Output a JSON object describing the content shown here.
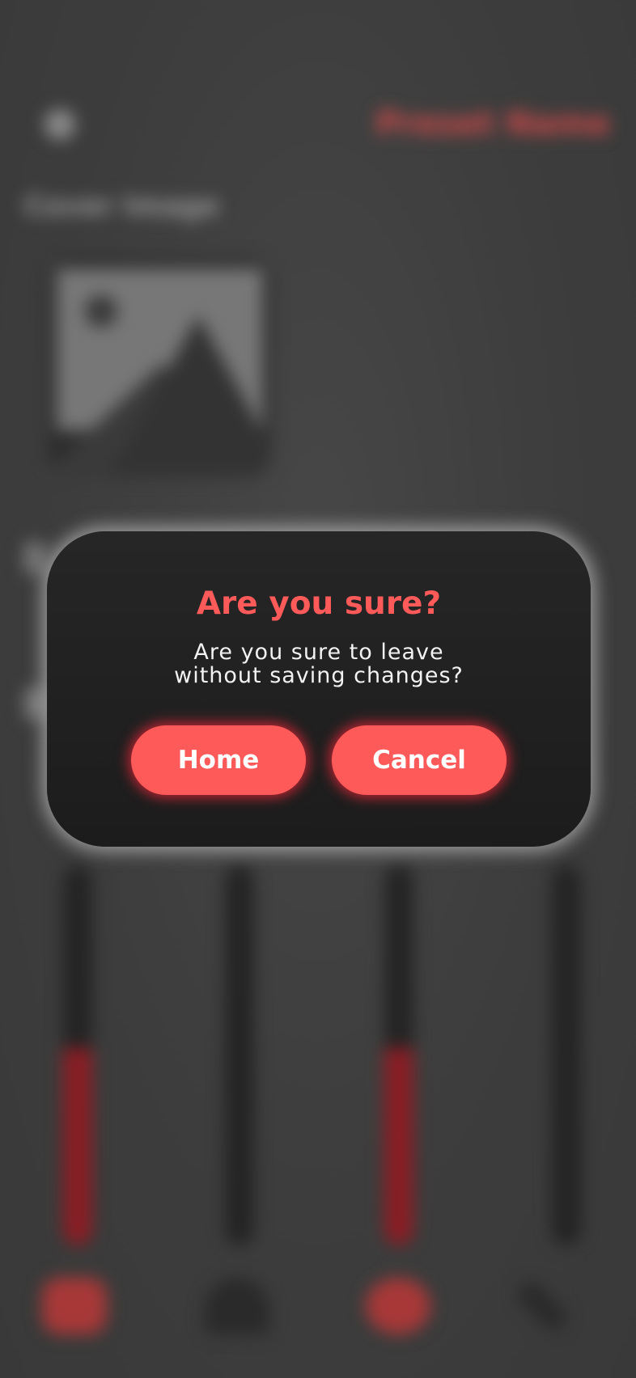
{
  "background": {
    "preset_name": "Preset Name",
    "cover_image_label": "Cover Image",
    "sliders": [
      {
        "level": 0.52,
        "accent": "#8a1d24"
      },
      {
        "level": 0.0,
        "accent": "#242424"
      },
      {
        "level": 0.52,
        "accent": "#8a1d24"
      },
      {
        "level": 0.0,
        "accent": "#242424"
      }
    ],
    "tabs": [
      {
        "icon": "sliders-icon",
        "active": true
      },
      {
        "icon": "home-icon",
        "active": false
      },
      {
        "icon": "camera-icon",
        "active": true
      },
      {
        "icon": "edit-icon",
        "active": false
      }
    ]
  },
  "dialog": {
    "title": "Are you sure?",
    "message_line1": "Are you sure to leave",
    "message_line2": "without saving changes?",
    "home_label": "Home",
    "cancel_label": "Cancel"
  },
  "colors": {
    "accent": "#ff5a5a",
    "dialog_bg": "#1f1f1f",
    "screen_bg": "#3f3f3f"
  }
}
